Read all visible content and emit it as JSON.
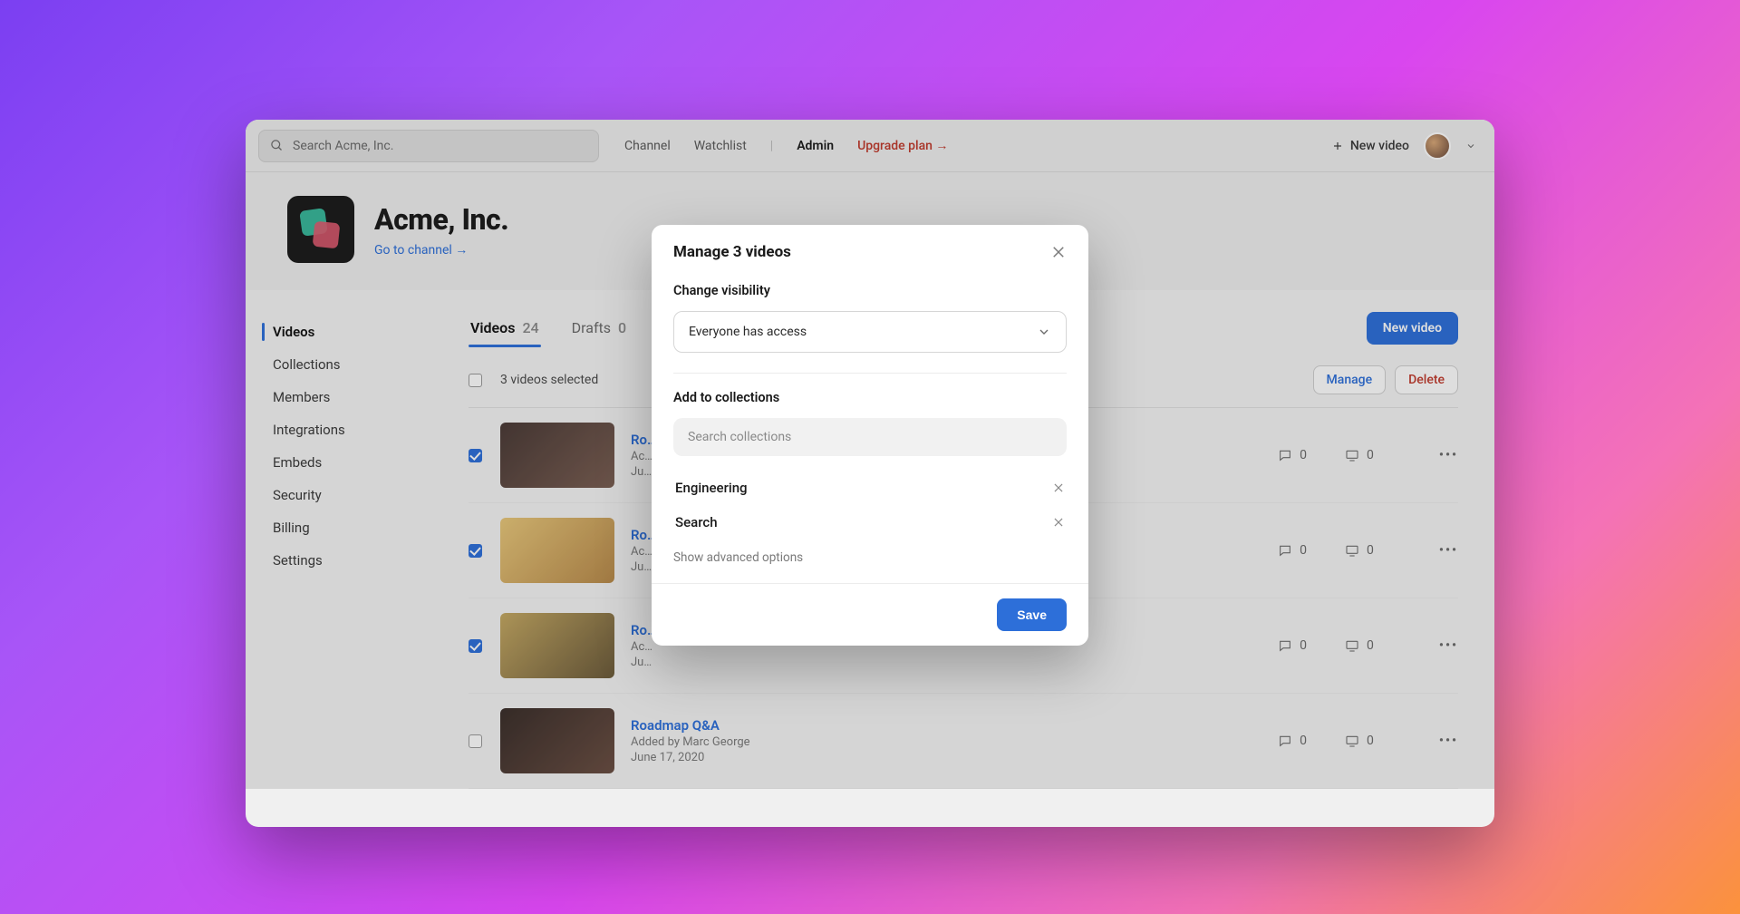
{
  "topbar": {
    "search_placeholder": "Search Acme, Inc.",
    "links": {
      "channel": "Channel",
      "watchlist": "Watchlist",
      "admin": "Admin",
      "upgrade": "Upgrade plan →"
    },
    "new_video": "New video"
  },
  "header": {
    "org_name": "Acme, Inc.",
    "go_to_channel": "Go to channel →"
  },
  "sidebar": {
    "items": [
      "Videos",
      "Collections",
      "Members",
      "Integrations",
      "Embeds",
      "Security",
      "Billing",
      "Settings"
    ],
    "active_index": 0
  },
  "tabs": {
    "videos_label": "Videos",
    "videos_count": "24",
    "drafts_label": "Drafts",
    "drafts_count": "0",
    "active": "videos"
  },
  "new_video_button": "New video",
  "selection": {
    "text": "3 videos selected",
    "manage": "Manage",
    "delete": "Delete"
  },
  "videos": [
    {
      "title": "Ro…",
      "by": "Ac…",
      "date": "Ju…",
      "comments": "0",
      "views": "0",
      "checked": true
    },
    {
      "title": "Ro…",
      "by": "Ac…",
      "date": "Ju…",
      "comments": "0",
      "views": "0",
      "checked": true
    },
    {
      "title": "Ro…",
      "by": "Ac…",
      "date": "Ju…",
      "comments": "0",
      "views": "0",
      "checked": true
    },
    {
      "title": "Roadmap Q&A",
      "by": "Added by Marc George",
      "date": "June 17, 2020",
      "comments": "0",
      "views": "0",
      "checked": false
    }
  ],
  "modal": {
    "title": "Manage 3 videos",
    "visibility_label": "Change visibility",
    "visibility_value": "Everyone has access",
    "add_label": "Add to collections",
    "search_placeholder": "Search collections",
    "collections": [
      "Engineering",
      "Search"
    ],
    "advanced": "Show advanced options",
    "save": "Save"
  }
}
